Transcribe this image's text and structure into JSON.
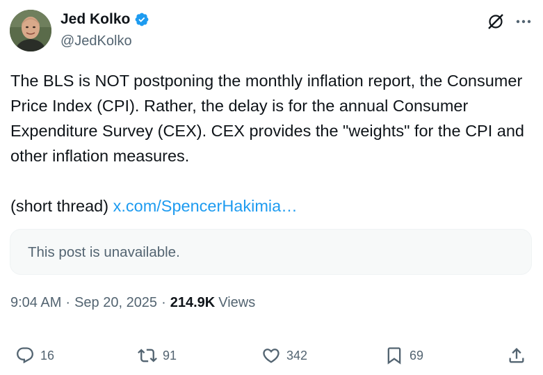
{
  "author": {
    "display_name": "Jed Kolko",
    "handle": "@JedKolko",
    "verified": true
  },
  "tweet": {
    "paragraph1": "The BLS is NOT postponing the monthly inflation report, the Consumer Price Index (CPI). Rather, the delay is for the annual Consumer Expenditure Survey (CEX). CEX provides the \"weights\" for the CPI and other inflation measures.",
    "paragraph2_prefix": "(short thread) ",
    "paragraph2_link": "x.com/SpencerHakimia…"
  },
  "quoted_post": {
    "text": "This post is unavailable."
  },
  "meta": {
    "time": "9:04 AM",
    "separator": "·",
    "date": "Sep 20, 2025",
    "views_count": "214.9K",
    "views_label": "Views"
  },
  "actions": {
    "replies": "16",
    "reposts": "91",
    "likes": "342",
    "bookmarks": "69"
  },
  "colors": {
    "link": "#1d9bf0",
    "verified_badge": "#1d9bf0",
    "secondary_text": "#536471"
  },
  "icons": [
    "verified-badge-icon",
    "grok-icon",
    "more-icon",
    "reply-icon",
    "repost-icon",
    "like-icon",
    "bookmark-icon",
    "share-icon"
  ]
}
